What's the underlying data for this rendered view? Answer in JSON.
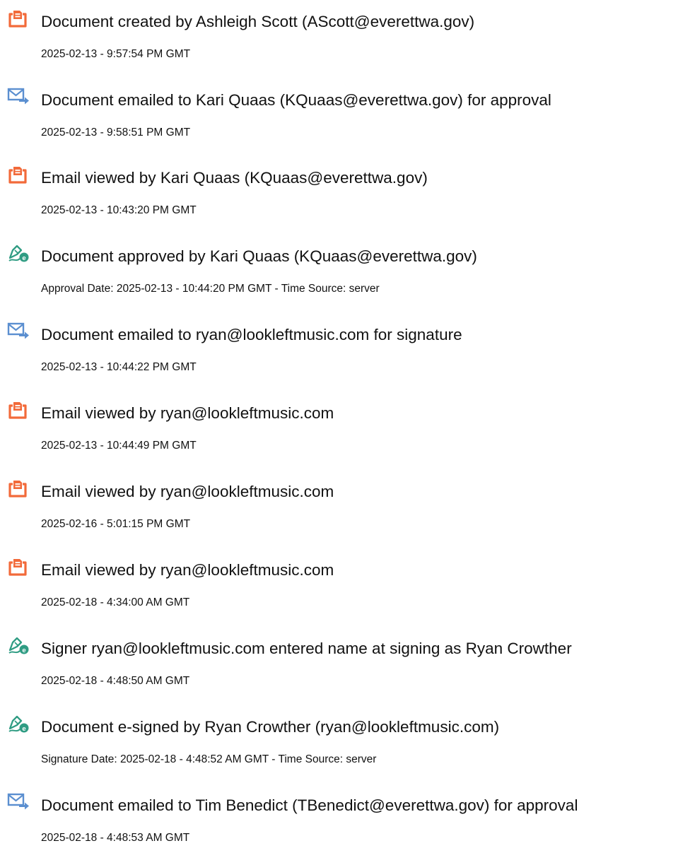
{
  "colors": {
    "document_icon": "#f26a3a",
    "email_icon": "#5b8fd0",
    "signature_icon": "#2f9c83"
  },
  "audit_log": [
    {
      "icon": "document-icon",
      "title": "Document created by Ashleigh Scott (AScott@everettwa.gov)",
      "detail": "2025-02-13 - 9:57:54 PM GMT"
    },
    {
      "icon": "email-icon",
      "title": "Document emailed to Kari Quaas (KQuaas@everettwa.gov) for approval",
      "detail": "2025-02-13 - 9:58:51 PM GMT"
    },
    {
      "icon": "document-icon",
      "title": "Email viewed by Kari Quaas (KQuaas@everettwa.gov)",
      "detail": "2025-02-13 - 10:43:20 PM GMT"
    },
    {
      "icon": "signature-icon",
      "title": "Document approved by Kari Quaas (KQuaas@everettwa.gov)",
      "detail": "Approval Date: 2025-02-13 - 10:44:20 PM GMT - Time Source: server"
    },
    {
      "icon": "email-icon",
      "title": "Document emailed to ryan@lookleftmusic.com for signature",
      "detail": "2025-02-13 - 10:44:22 PM GMT"
    },
    {
      "icon": "document-icon",
      "title": "Email viewed by ryan@lookleftmusic.com",
      "detail": "2025-02-13 - 10:44:49 PM GMT"
    },
    {
      "icon": "document-icon",
      "title": "Email viewed by ryan@lookleftmusic.com",
      "detail": "2025-02-16 - 5:01:15 PM GMT"
    },
    {
      "icon": "document-icon",
      "title": "Email viewed by ryan@lookleftmusic.com",
      "detail": "2025-02-18 - 4:34:00 AM GMT"
    },
    {
      "icon": "signature-icon",
      "title": "Signer ryan@lookleftmusic.com entered name at signing as Ryan Crowther",
      "detail": "2025-02-18 - 4:48:50 AM GMT"
    },
    {
      "icon": "signature-icon",
      "title": "Document e-signed by Ryan Crowther (ryan@lookleftmusic.com)",
      "detail": "Signature Date: 2025-02-18 - 4:48:52 AM GMT - Time Source: server"
    },
    {
      "icon": "email-icon",
      "title": "Document emailed to Tim Benedict (TBenedict@everettwa.gov) for approval",
      "detail": "2025-02-18 - 4:48:53 AM GMT"
    }
  ]
}
